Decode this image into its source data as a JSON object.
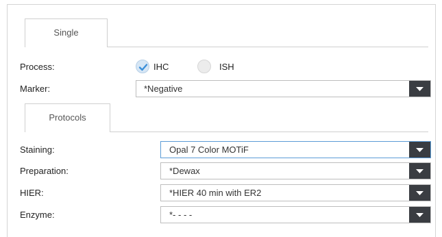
{
  "tabs": {
    "single": "Single",
    "protocols": "Protocols"
  },
  "process": {
    "label": "Process:",
    "options": [
      {
        "label": "IHC",
        "checked": true
      },
      {
        "label": "ISH",
        "checked": false
      }
    ]
  },
  "marker": {
    "label": "Marker:",
    "value": "*Negative"
  },
  "protocols": {
    "staining": {
      "label": "Staining:",
      "value": "Opal 7 Color MOTiF"
    },
    "preparation": {
      "label": "Preparation:",
      "value": "*Dewax"
    },
    "hier": {
      "label": "HIER:",
      "value": "*HIER 40 min with ER2"
    },
    "enzyme": {
      "label": "Enzyme:",
      "value": "*- - - -"
    }
  },
  "icons": {
    "dropdown": "chevron-down-icon",
    "check": "checkmark-icon"
  },
  "colors": {
    "accent": "#5a9bd6",
    "button_bg": "#3a3d42",
    "radio_checked_bg": "#d6e6f5"
  }
}
